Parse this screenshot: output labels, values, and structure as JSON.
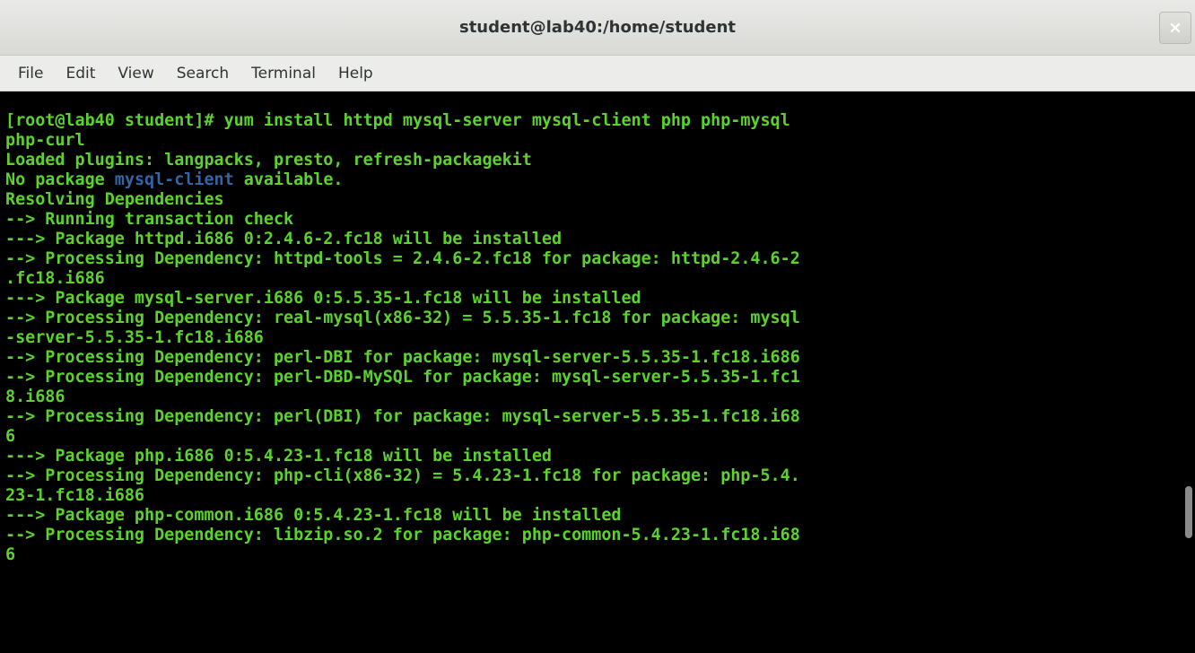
{
  "window": {
    "title": "student@lab40:/home/student",
    "close_icon": "close-icon"
  },
  "menu": {
    "items": [
      "File",
      "Edit",
      "View",
      "Search",
      "Terminal",
      "Help"
    ]
  },
  "colors": {
    "terminal_fg": "#5bd32c",
    "highlight": "#3465a4",
    "background": "#000000"
  },
  "terminal": {
    "lines": [
      "[root@lab40 student]# yum install httpd mysql-server mysql-client php php-mysql",
      "php-curl",
      "Loaded plugins: langpacks, presto, refresh-packagekit",
      "No package ",
      "Resolving Dependencies",
      "--> Running transaction check",
      "---> Package httpd.i686 0:2.4.6-2.fc18 will be installed",
      "--> Processing Dependency: httpd-tools = 2.4.6-2.fc18 for package: httpd-2.4.6-2",
      ".fc18.i686",
      "---> Package mysql-server.i686 0:5.5.35-1.fc18 will be installed",
      "--> Processing Dependency: real-mysql(x86-32) = 5.5.35-1.fc18 for package: mysql",
      "-server-5.5.35-1.fc18.i686",
      "--> Processing Dependency: perl-DBI for package: mysql-server-5.5.35-1.fc18.i686",
      "--> Processing Dependency: perl-DBD-MySQL for package: mysql-server-5.5.35-1.fc1",
      "8.i686",
      "--> Processing Dependency: perl(DBI) for package: mysql-server-5.5.35-1.fc18.i68",
      "6",
      "---> Package php.i686 0:5.4.23-1.fc18 will be installed",
      "--> Processing Dependency: php-cli(x86-32) = 5.4.23-1.fc18 for package: php-5.4.",
      "23-1.fc18.i686",
      "---> Package php-common.i686 0:5.4.23-1.fc18 will be installed",
      "--> Processing Dependency: libzip.so.2 for package: php-common-5.4.23-1.fc18.i68",
      "6"
    ],
    "no_package_prefix": "No package ",
    "no_package_name": "mysql-client",
    "no_package_suffix": " available."
  }
}
